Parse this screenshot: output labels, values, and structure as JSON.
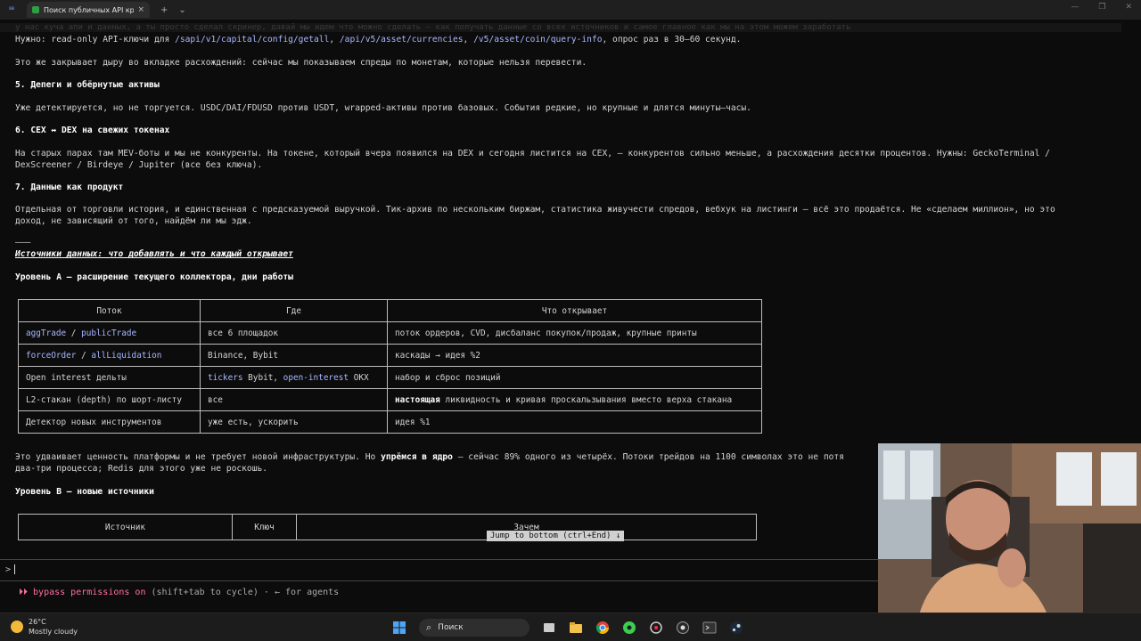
{
  "window": {
    "tab_title": "Поиск публичных API кр",
    "tab_close": "×",
    "new_tab": "+",
    "tab_menu": "⌄",
    "minimize": "—",
    "maximize": "❐",
    "close": "✕"
  },
  "terminal": {
    "faded_line": "у нас куча апи и данных, а ты просто сделал скринер, давай мы идем что можно сделать — как получать данные со всех источников и самое главное как мы на этом можем заработать",
    "need_prefix": "Нужно: read-only API-ключи для ",
    "need_code1": "/sapi/v1/capital/config/getall",
    "need_sep1": ", ",
    "need_code2": "/api/v5/asset/currencies",
    "need_sep2": ", ",
    "need_code3": "/v5/asset/coin/query-info",
    "need_suffix": ", опрос раз в 30–60 секунд.",
    "gap_line": "Это же закрывает дыру во вкладке расхождений: сейчас мы показываем спреды по монетам, которые нельзя перевести.",
    "h5": "5. Депеги и обёрнутые активы",
    "p5": "Уже детектируется, но не торгуется. USDC/DAI/FDUSD против USDT, wrapped-активы против базовых. События редкие, но крупные и длятся минуты–часы.",
    "h6": "6. CEX ↔ DEX на свежих токенах",
    "p6a": "На старых парах там MEV-боты и мы не конкуренты. На токене, который вчера появился на DEX и сегодня листится на CEX, — конкурентов сильно меньше, а расхождения десятки процентов. Нужны: GeckoTerminal /",
    "p6b": "DexScreener / Birdeye / Jupiter (все без ключа).",
    "h7": "7. Данные как продукт",
    "p7a": "Отдельная от торговли история, и единственная с предсказуемой выручкой. Тик-архив по нескольким биржам, статистика живучести спредов, вебхук на листинги — всё это продаётся. Не «сделаем миллион», но это",
    "p7b": "доход, не зависящий от того, найдём ли мы эдж.",
    "rule": "———",
    "sources_heading": "Источники данных: что добавлять и что каждый открывает",
    "level_a": "Уровень A — расширение текущего коллектора, дни работы",
    "table_a": {
      "headers": [
        "Поток",
        "Где",
        "Что открывает"
      ],
      "rows": [
        {
          "stream_a": "aggTrade",
          "stream_sep": " / ",
          "stream_b": "publicTrade",
          "where": "все 6 площадок",
          "opens": "поток ордеров, CVD, дисбаланс покупок/продаж, крупные принты"
        },
        {
          "stream_a": "forceOrder",
          "stream_sep": " / ",
          "stream_b": "allLiquidation",
          "where": "Binance, Bybit",
          "opens": "каскады → идея %2"
        },
        {
          "stream_plain": "Open interest дельты",
          "where_a": "tickers",
          "where_mid": " Bybit, ",
          "where_b": "open-interest",
          "where_end": " OKX",
          "opens": "набор и сброс позиций"
        },
        {
          "stream_plain": "L2-стакан (depth) по шорт-листу",
          "where": "все",
          "opens_bold": "настоящая",
          "opens": " ликвидность и кривая проскальзывания вместо верха стакана"
        },
        {
          "stream_plain": "Детектор новых инструментов",
          "where": "уже есть, ускорить",
          "opens": "идея %1"
        }
      ]
    },
    "p_after_a1": "Это удваивает ценность платформы и не требует новой инфраструктуры. Но ",
    "p_after_bold": "упрёмся в ядро",
    "p_after_a2": " — сейчас 89% одного из четырёх. Потоки трейдов на 1100 символах это не потя",
    "p_after_b": "два-три процесса; Redis для этого уже не роскошь.",
    "level_b": "Уровень B — новые источники",
    "table_b_headers": [
      "Источник",
      "Ключ",
      "Зачем"
    ],
    "jump_label": "Jump to bottom (ctrl+End) ↓"
  },
  "prompt": {
    "symbol": ">"
  },
  "status": {
    "arrows": "⏵⏵",
    "mode": "bypass permissions on",
    "hint": " (shift+tab to cycle) · ← for agents"
  },
  "taskbar": {
    "temp": "26°C",
    "weather": "Mostly cloudy",
    "search_label": "Поиск",
    "search_glyph": "⌕"
  },
  "colors": {
    "code": "#a9b7ff",
    "status_accent": "#ff6fa6",
    "background": "#0c0c0c"
  }
}
